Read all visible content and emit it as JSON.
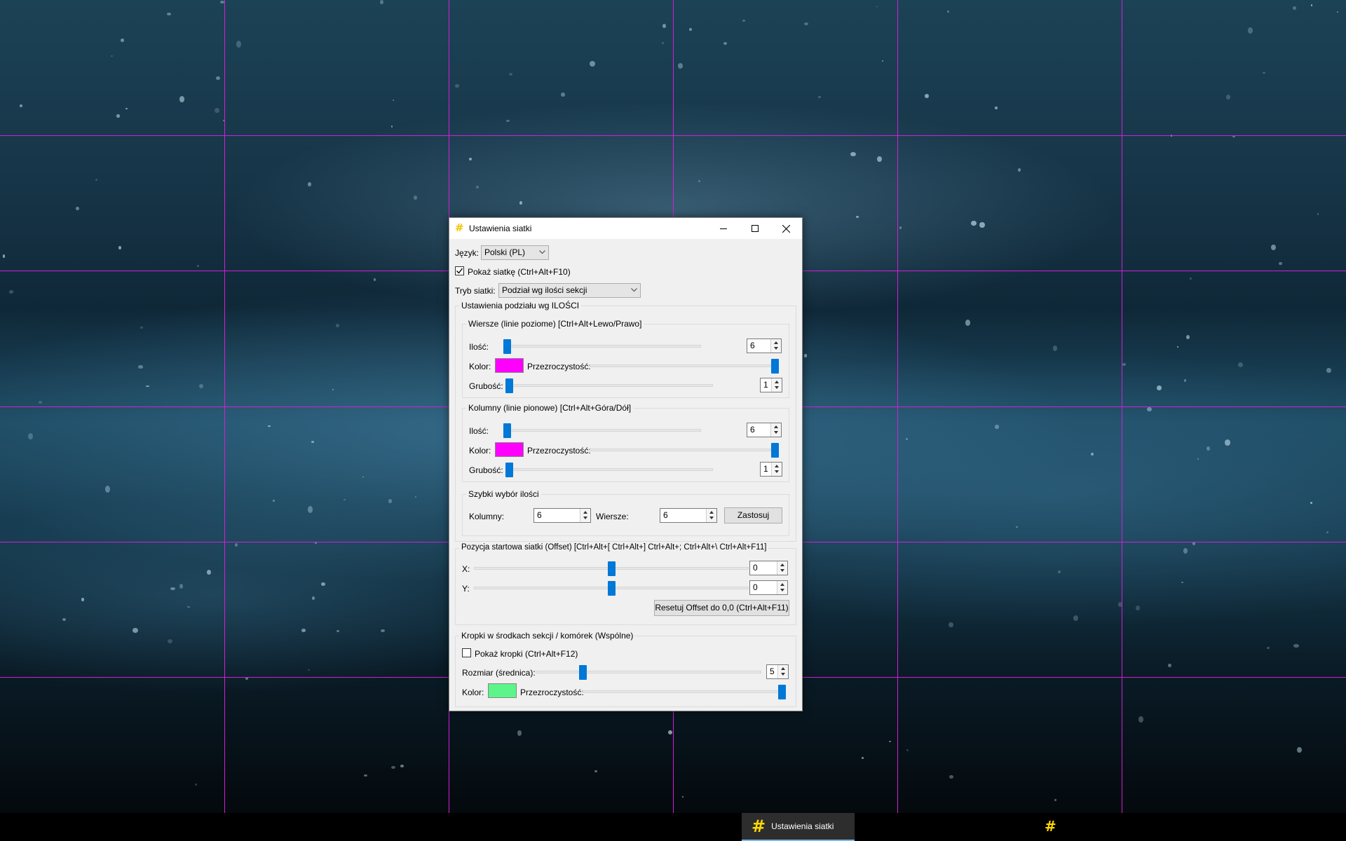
{
  "colors": {
    "grid_line": "#d21fd6",
    "row_color": "#ff00ff",
    "col_color": "#ff00ff",
    "dot_color": "#5cf58a",
    "accent": "#0078d7",
    "app_icon": "#ffd800"
  },
  "window": {
    "title": "Ustawienia siatki",
    "icon": "hash-icon",
    "controls": [
      "minimize-icon",
      "maximize-icon",
      "close-icon"
    ]
  },
  "language": {
    "label": "Język:",
    "value": "Polski (PL)"
  },
  "show_grid": {
    "label": "Pokaż siatkę (Ctrl+Alt+F10)",
    "checked": true
  },
  "mode": {
    "label": "Tryb siatki:",
    "value": "Podział wg ilości sekcji"
  },
  "count_settings": {
    "title": "Ustawienia podziału wg ILOŚCI",
    "rows": {
      "title": "Wiersze (linie poziome) [Ctrl+Alt+Lewo/Prawo]",
      "count_label": "Ilość:",
      "count": "6",
      "count_slider": 0.0,
      "color_label": "Kolor:",
      "opacity_label": "Przezroczystość:",
      "opacity": 1.0,
      "thickness_label": "Grubość:",
      "thickness": "1",
      "thickness_slider": 0.0
    },
    "cols": {
      "title": "Kolumny (linie pionowe) [Ctrl+Alt+Góra/Dół]",
      "count_label": "Ilość:",
      "count": "6",
      "count_slider": 0.0,
      "color_label": "Kolor:",
      "opacity_label": "Przezroczystość:",
      "opacity": 1.0,
      "thickness_label": "Grubość:",
      "thickness": "1",
      "thickness_slider": 0.0
    },
    "quick": {
      "title": "Szybki wybór ilości",
      "cols_label": "Kolumny:",
      "cols_value": "6",
      "rows_label": "Wiersze:",
      "rows_value": "6",
      "apply_label": "Zastosuj"
    }
  },
  "offset": {
    "title": "Pozycja startowa siatki (Offset) [Ctrl+Alt+[ Ctrl+Alt+] Ctrl+Alt+; Ctrl+Alt+\\ Ctrl+Alt+F11]",
    "x_label": "X:",
    "x_value": "0",
    "x_slider": 0.5,
    "y_label": "Y:",
    "y_value": "0",
    "y_slider": 0.5,
    "reset_label": "Resetuj Offset do 0,0 (Ctrl+Alt+F11)"
  },
  "dots": {
    "title": "Kropki w środkach sekcji / komórek (Wspólne)",
    "show_label": "Pokaż kropki (Ctrl+Alt+F12)",
    "show_checked": false,
    "size_label": "Rozmiar (średnica):",
    "size": "5",
    "size_slider": 0.2,
    "color_label": "Kolor:",
    "opacity_label": "Przezroczystość:",
    "opacity": 1.0
  },
  "taskbar": {
    "item_label": "Ustawienia siatki"
  }
}
